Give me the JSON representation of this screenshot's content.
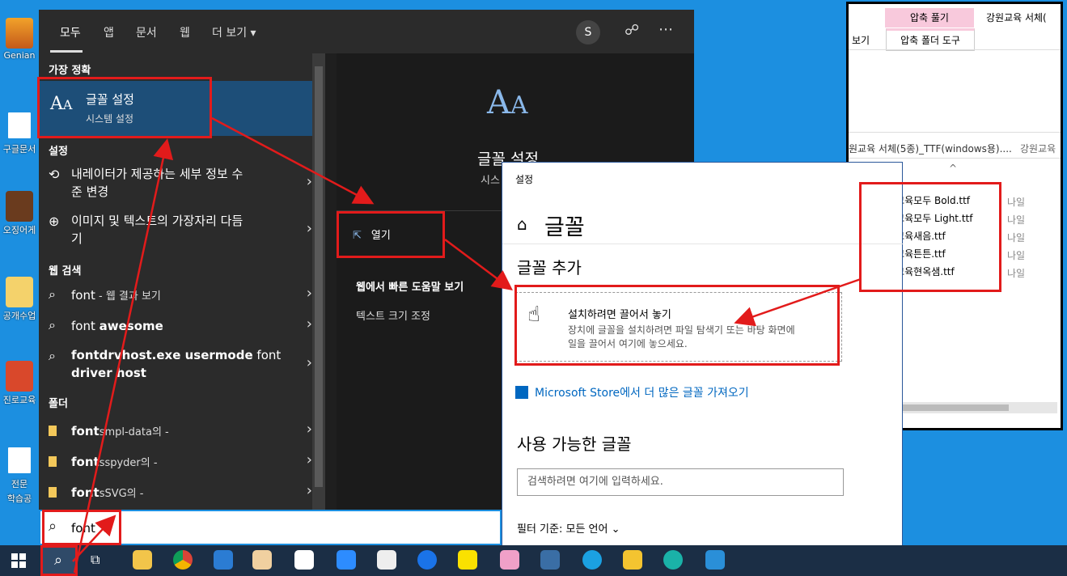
{
  "desktop": {
    "icons": [
      {
        "label": "Genian"
      },
      {
        "label": "구글문서"
      },
      {
        "label": "오징어게"
      },
      {
        "label": "공개수업"
      },
      {
        "label": "진로교육"
      },
      {
        "label": "전문"
      },
      {
        "label": "학습공"
      }
    ]
  },
  "start_menu": {
    "tabs": [
      "모두",
      "앱",
      "문서",
      "웹",
      "더 보기"
    ],
    "avatar_letter": "S",
    "best_match": {
      "header": "가장 정확",
      "title": "글꼴 설정",
      "subtitle": "시스템 설정"
    },
    "settings_section": {
      "header": "설정",
      "items": [
        {
          "line1": "내레이터가 제공하는 세부 정보 수",
          "line2": "준 변경"
        },
        {
          "line1": "이미지 및 텍스트의 가장자리 다듬",
          "line2": "기"
        }
      ]
    },
    "web_section": {
      "header": "웹 검색",
      "items": [
        {
          "prefix": "font",
          "suffix": " - 웹 결과 보기"
        },
        {
          "prefix": "font ",
          "bold": "awesome"
        },
        {
          "bold1": "fontdrvhost.exe usermode",
          "plain": " font",
          "bold2": "driver host"
        }
      ]
    },
    "folder_section": {
      "header": "폴더",
      "items": [
        {
          "bold": "font",
          "rest": "smpl-data의 -"
        },
        {
          "bold": "font",
          "rest": "sspyder의 -"
        },
        {
          "bold": "font",
          "rest": "sSVG의 -"
        }
      ]
    },
    "right_pane": {
      "title": "글꼴 설정",
      "subtitle": "시스",
      "open_label": "열기",
      "web_help_header": "웹에서 빠른 도움말 보기",
      "web_help_item": "텍스트 크기 조정"
    },
    "search_value": "font"
  },
  "settings_window": {
    "window_title": "설정",
    "page_title": "글꼴",
    "add_fonts_header": "글꼴 추가",
    "drop_title": "설치하려면 끌어서 놓기",
    "drop_desc_line1": "장치에 글꼴을 설치하려면 파일 탐색기 또는 바탕 화면에",
    "drop_desc_line2": "일을 끌어서 여기에 놓으세요.",
    "store_link": "Microsoft Store에서 더 많은 글꼴 가져오기",
    "available_header": "사용 가능한 글꼴",
    "search_placeholder": "검색하려면 여기에 입력하세요.",
    "filter_label": "필터 기준:",
    "filter_value": "모든 언어"
  },
  "explorer": {
    "ribbon_tab_highlight": "압축 풀기",
    "window_title": "강원교육 서체(",
    "ribbon_tab_view": "보기",
    "ribbon_tab_tools": "압축 폴더 도구",
    "path_left": "원교육 서체(5종)_TTF(windows용)....",
    "path_right": "강원교육",
    "column_name": "이름",
    "files": [
      "강원교육모두 Bold.ttf",
      "강원교육모두 Light.ttf",
      "강원교육새음.ttf",
      "강원교육튼튼.ttf",
      "강원교육현옥샘.ttf"
    ],
    "type_partial": "나일"
  },
  "colors": {
    "accent": "#1c8fe0",
    "highlight": "#e21b1b",
    "best_match_bg": "#1d4e78",
    "link": "#0067c0"
  }
}
